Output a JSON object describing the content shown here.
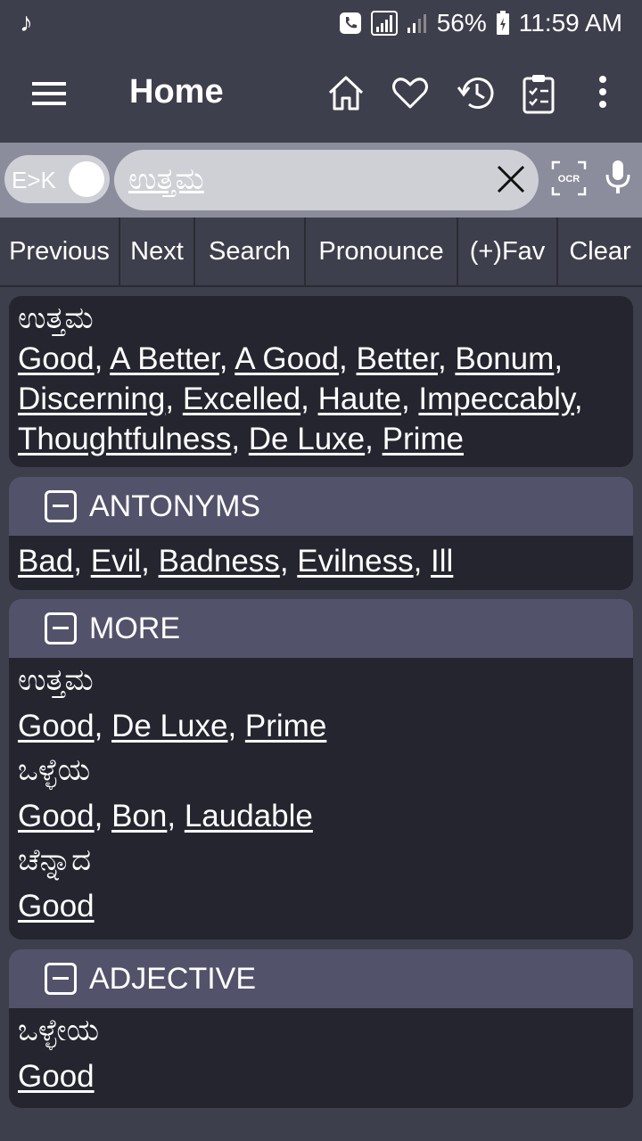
{
  "status_bar": {
    "battery": "56%",
    "time": "11:59 AM",
    "icons": [
      "music-note-icon",
      "call-icon",
      "signal-icon",
      "signal-weak-icon",
      "battery-icon"
    ]
  },
  "app_bar": {
    "title": "Home",
    "icons": [
      "menu-icon",
      "home-icon",
      "heart-icon",
      "history-icon",
      "clipboard-icon",
      "more-icon"
    ]
  },
  "search": {
    "toggle_label": "E>K",
    "query": "ಉತ್ತಮ",
    "ocr_label": "OCR"
  },
  "toolbar": {
    "buttons": [
      "Previous",
      "Next",
      "Search",
      "Pronounce",
      "(+)Fav",
      "Clear"
    ]
  },
  "main": {
    "word": "ಉತ್ತಮ",
    "translations": [
      "Good",
      "A Better",
      "A Good",
      "Better",
      "Bonum",
      "Discerning",
      "Excelled",
      "Haute",
      "Impeccably",
      "Thoughtfulness",
      "De Luxe",
      "Prime"
    ]
  },
  "antonyms": {
    "header": "ANTONYMS",
    "words": [
      "Bad",
      "Evil",
      "Badness",
      "Evilness",
      "Ill"
    ]
  },
  "more": {
    "header": "MORE",
    "entries": [
      {
        "word": "ಉತ್ತಮ",
        "translations": [
          "Good",
          "De Luxe",
          "Prime"
        ]
      },
      {
        "word": "ಒಳ್ಳೆಯ",
        "translations": [
          "Good",
          "Bon",
          "Laudable"
        ]
      },
      {
        "word": "ಚೆನ್ನಾದ",
        "translations": [
          "Good"
        ]
      }
    ]
  },
  "adjective": {
    "header": "ADJECTIVE",
    "entries": [
      {
        "word": "ಒಳ್ಳೇಯ",
        "translations": [
          "Good"
        ]
      }
    ]
  },
  "colors": {
    "background": "#3e3f4c",
    "search_bar": "#8b8c9c",
    "card": "#252530",
    "card_header": "#52536a"
  }
}
